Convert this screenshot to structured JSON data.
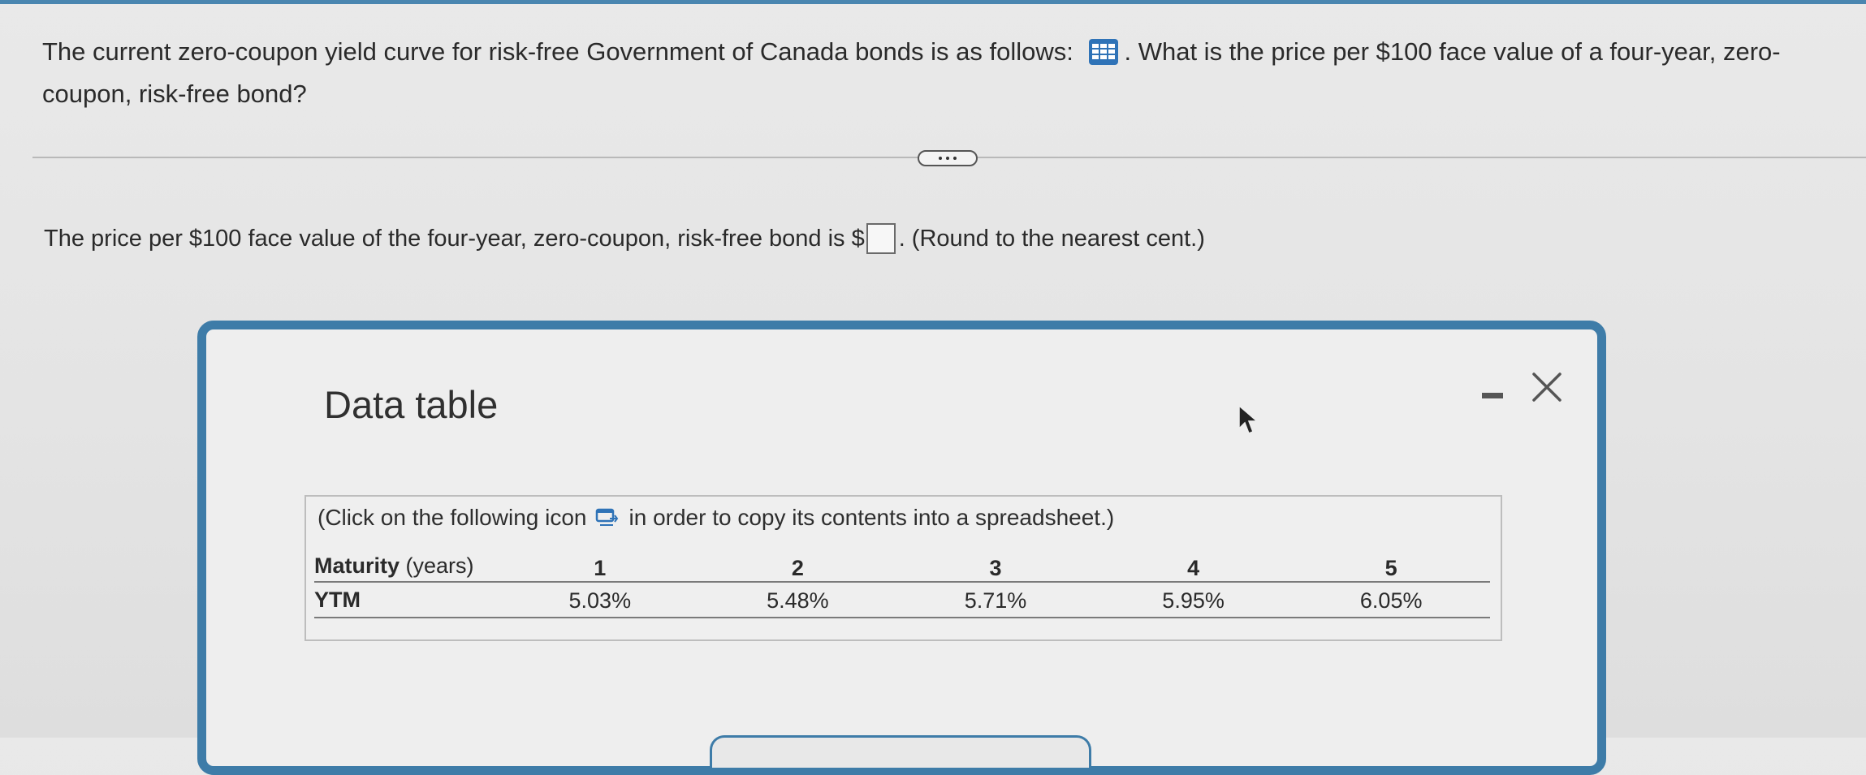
{
  "question": {
    "text_before_icon": "The current zero-coupon yield curve for risk-free Government of Canada bonds is as follows: ",
    "text_after_icon": ". What is the price per $100 face value of a four-year, zero-coupon, risk-free bond?"
  },
  "answer": {
    "prefix": "The price per $100 face value of the four-year, zero-coupon, risk-free bond is $",
    "input_value": "",
    "suffix": ".",
    "note": "(Round to the nearest cent.)"
  },
  "dialog": {
    "title": "Data table",
    "instruction_before_icon": "(Click on the following icon ",
    "instruction_after_icon": " in order to copy its contents into a spreadsheet.)",
    "table": {
      "header_label_bold": "Maturity",
      "header_label_light": " (years)",
      "row_label": "YTM",
      "maturities": [
        "1",
        "2",
        "3",
        "4",
        "5"
      ],
      "ytm": [
        "5.03%",
        "5.48%",
        "5.71%",
        "5.95%",
        "6.05%"
      ]
    }
  },
  "colors": {
    "accent": "#3e7ca8",
    "table_icon": "#2f73b7"
  },
  "icons": [
    "table-icon",
    "more-icon",
    "minimize-icon",
    "close-icon",
    "copy-icon",
    "cursor-icon"
  ]
}
